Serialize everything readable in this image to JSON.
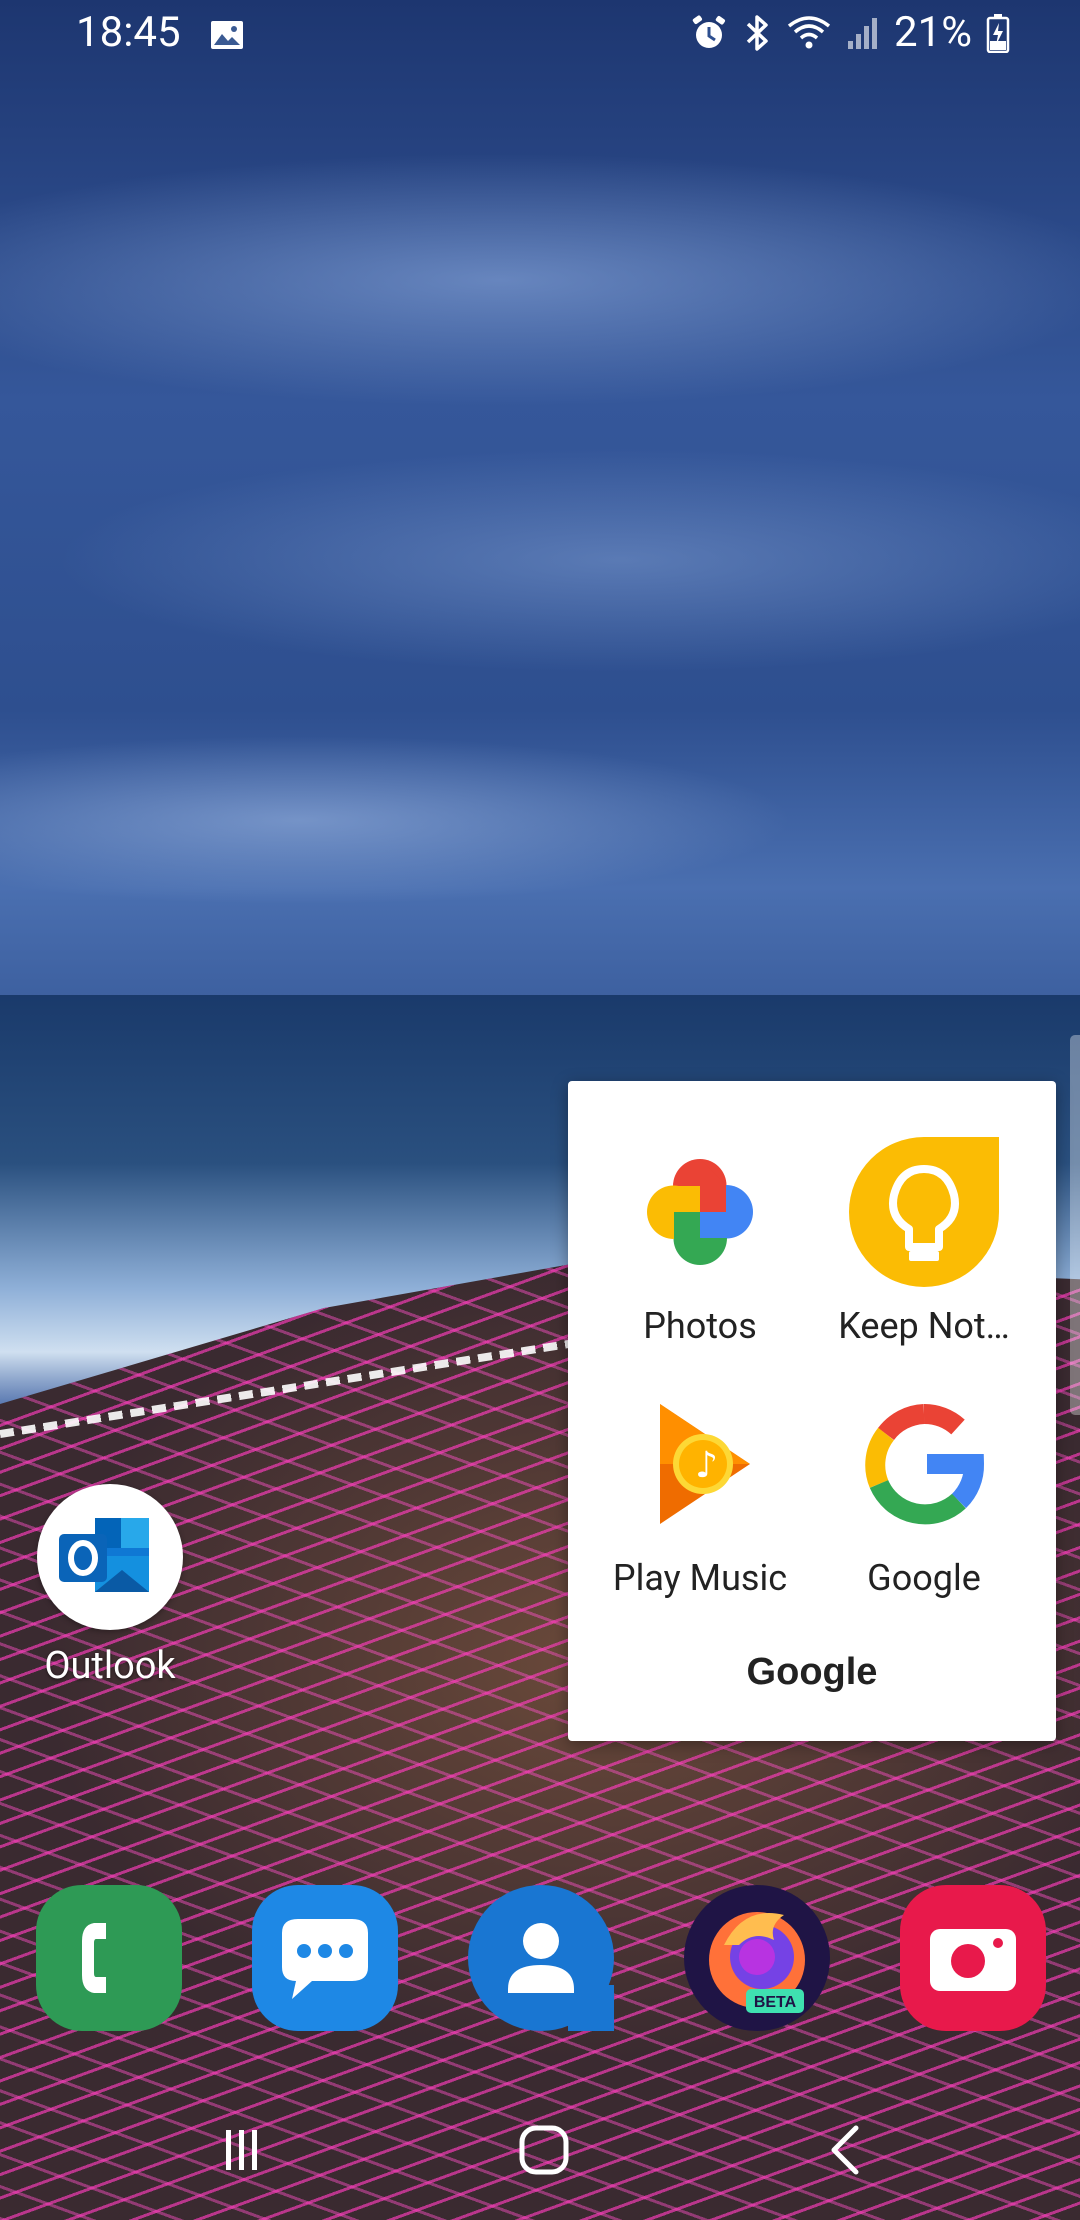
{
  "status_bar": {
    "time": "18:45",
    "battery_percent": "21%",
    "icons": [
      "gallery-icon",
      "alarm-icon",
      "bluetooth-icon",
      "wifi-icon",
      "signal-icon",
      "battery-charging-icon"
    ]
  },
  "folder": {
    "title": "Google",
    "apps": [
      {
        "label": "Photos",
        "icon": "google-photos-icon"
      },
      {
        "label": "Keep Not…",
        "icon": "google-keep-icon"
      },
      {
        "label": "Play Music",
        "icon": "play-music-icon"
      },
      {
        "label": "Google",
        "icon": "google-icon"
      }
    ]
  },
  "home_apps": [
    {
      "label": "Outlook",
      "icon": "outlook-icon"
    }
  ],
  "dock": [
    {
      "icon": "phone-icon",
      "color": "#2e9a55"
    },
    {
      "icon": "messages-icon",
      "color": "#1e88e5"
    },
    {
      "icon": "contacts-icon",
      "color": "#1976d2"
    },
    {
      "icon": "firefox-beta-icon",
      "badge": "BETA"
    },
    {
      "icon": "camera-icon",
      "color": "#e8194b"
    }
  ],
  "nav": {
    "buttons": [
      "recents-button",
      "home-button",
      "back-button"
    ]
  }
}
